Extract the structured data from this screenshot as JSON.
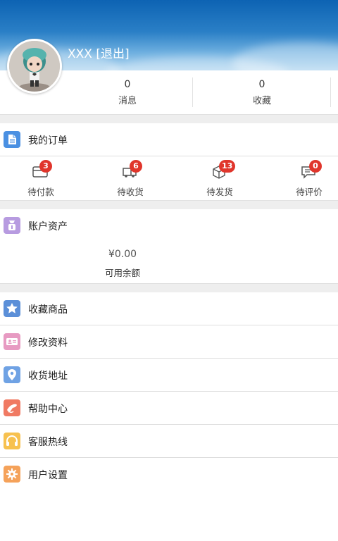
{
  "profile": {
    "username": "XXX [退出]"
  },
  "stats": [
    {
      "value": "0",
      "label": "消息"
    },
    {
      "value": "0",
      "label": "收藏"
    }
  ],
  "orders": {
    "title": "我的订单",
    "items": [
      {
        "label": "待付款",
        "badge": "3",
        "icon": "wallet-icon"
      },
      {
        "label": "待收货",
        "badge": "6",
        "icon": "delivery-truck-icon"
      },
      {
        "label": "待发货",
        "badge": "13",
        "icon": "package-box-icon"
      },
      {
        "label": "待评价",
        "badge": "0",
        "icon": "comment-icon"
      }
    ]
  },
  "assets": {
    "title": "账户资产",
    "balance_value": "¥0.00",
    "balance_label": "可用余额"
  },
  "menu": [
    {
      "label": "收藏商品",
      "icon": "star-icon",
      "color": "#5b8fd8"
    },
    {
      "label": "修改资料",
      "icon": "id-card-icon",
      "color": "#e79ac2"
    },
    {
      "label": "收货地址",
      "icon": "location-pin-icon",
      "color": "#6fa2e4"
    },
    {
      "label": "帮助中心",
      "icon": "help-hand-icon",
      "color": "#f07a63"
    },
    {
      "label": "客服热线",
      "icon": "headphones-icon",
      "color": "#f7c14f"
    },
    {
      "label": "用户设置",
      "icon": "gear-icon",
      "color": "#f5a25a"
    }
  ],
  "colors": {
    "header_blue": "#1a6fbf",
    "badge_red": "#e0352b",
    "order_icon": "#4a90e2",
    "assets_icon": "#b79be0"
  }
}
